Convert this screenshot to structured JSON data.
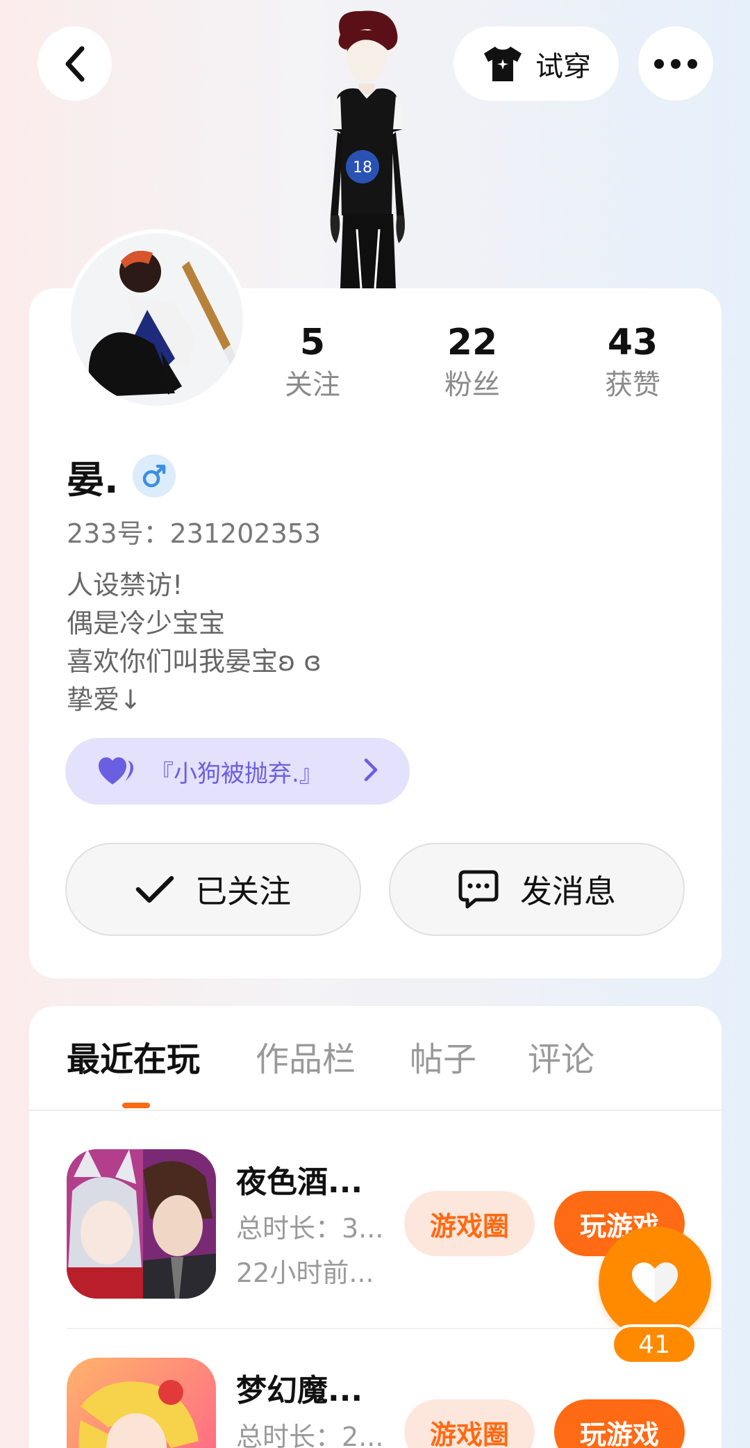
{
  "header": {
    "try_on_label": "试穿"
  },
  "profile": {
    "stats": [
      {
        "value": "5",
        "label": "关注"
      },
      {
        "value": "22",
        "label": "粉丝"
      },
      {
        "value": "43",
        "label": "获赞"
      }
    ],
    "nickname": "晏.",
    "gender_symbol": "♂",
    "user_id": "233号：231202353",
    "bio_lines": [
      "人设禁访!",
      "偶是冷少宝宝",
      "喜欢你们叫我晏宝ʚ ɞ",
      "挚爱↓"
    ],
    "tag_label": "『小狗被抛弃.』",
    "follow_label": "已关注",
    "message_label": "发消息"
  },
  "tabs": [
    {
      "label": "最近在玩",
      "active": true
    },
    {
      "label": "作品栏",
      "active": false
    },
    {
      "label": "帖子",
      "active": false
    },
    {
      "label": "评论",
      "active": false
    }
  ],
  "games": [
    {
      "title": "夜色酒...",
      "duration": "总时长：3...",
      "last_played": "22小时前...",
      "circle_label": "游戏圈",
      "play_label": "玩游戏"
    },
    {
      "title": "梦幻魔...",
      "duration": "总时长：2...",
      "last_played": "",
      "circle_label": "游戏圈",
      "play_label": "玩游戏"
    }
  ],
  "like_float": {
    "count": "41"
  },
  "colors": {
    "accent_orange": "#ff6a14",
    "like_orange": "#ff8a00",
    "tag_purple": "#6a5fe0",
    "tag_bg": "#e3e1fb",
    "gender_blue": "#3b8fe0"
  }
}
